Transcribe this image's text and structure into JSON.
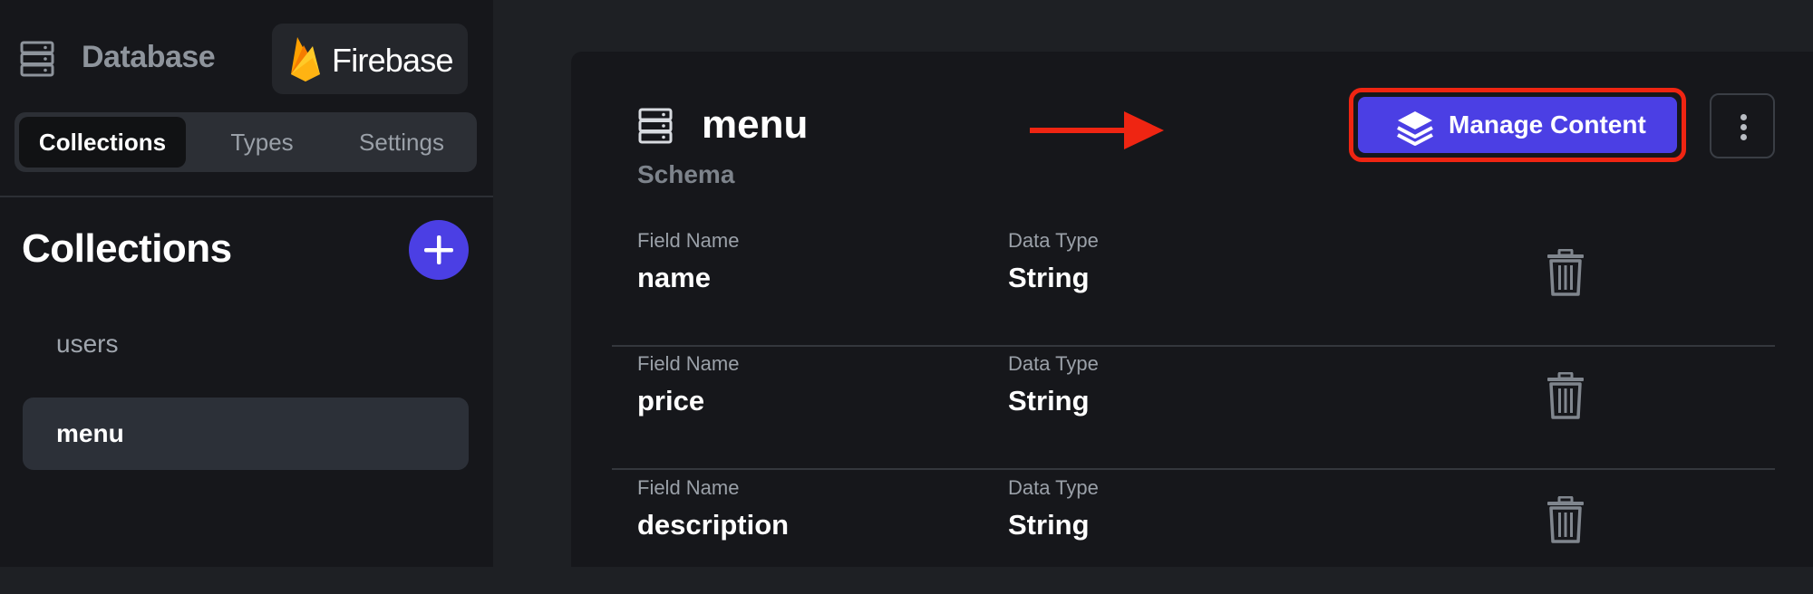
{
  "sidebar": {
    "title": "Database",
    "title_icon": "database-icon",
    "provider": {
      "name": "Firebase",
      "icon": "firebase-flame-icon"
    },
    "tabs": [
      {
        "label": "Collections",
        "active": true
      },
      {
        "label": "Types",
        "active": false
      },
      {
        "label": "Settings",
        "active": false
      }
    ],
    "section_title": "Collections",
    "add_icon": "plus-icon",
    "collections": [
      {
        "label": "users",
        "selected": false
      },
      {
        "label": "menu",
        "selected": true
      }
    ]
  },
  "main": {
    "title": "menu",
    "title_icon": "database-icon",
    "subtitle": "Schema",
    "manage_button": {
      "label": "Manage Content",
      "icon": "layers-icon"
    },
    "more_icon": "more-vertical-icon",
    "fields": [
      {
        "field_label": "Field Name",
        "name": "name",
        "type_label": "Data Type",
        "type": "String",
        "action_icon": "trash-icon"
      },
      {
        "field_label": "Field Name",
        "name": "price",
        "type_label": "Data Type",
        "type": "String",
        "action_icon": "trash-icon"
      },
      {
        "field_label": "Field Name",
        "name": "description",
        "type_label": "Data Type",
        "type": "String",
        "action_icon": "trash-icon"
      }
    ]
  },
  "colors": {
    "background": "#1e2024",
    "panel": "#16171b",
    "accent": "#4b3fe4",
    "annotation_red": "#ef2512",
    "selected_item": "#2c3038"
  }
}
